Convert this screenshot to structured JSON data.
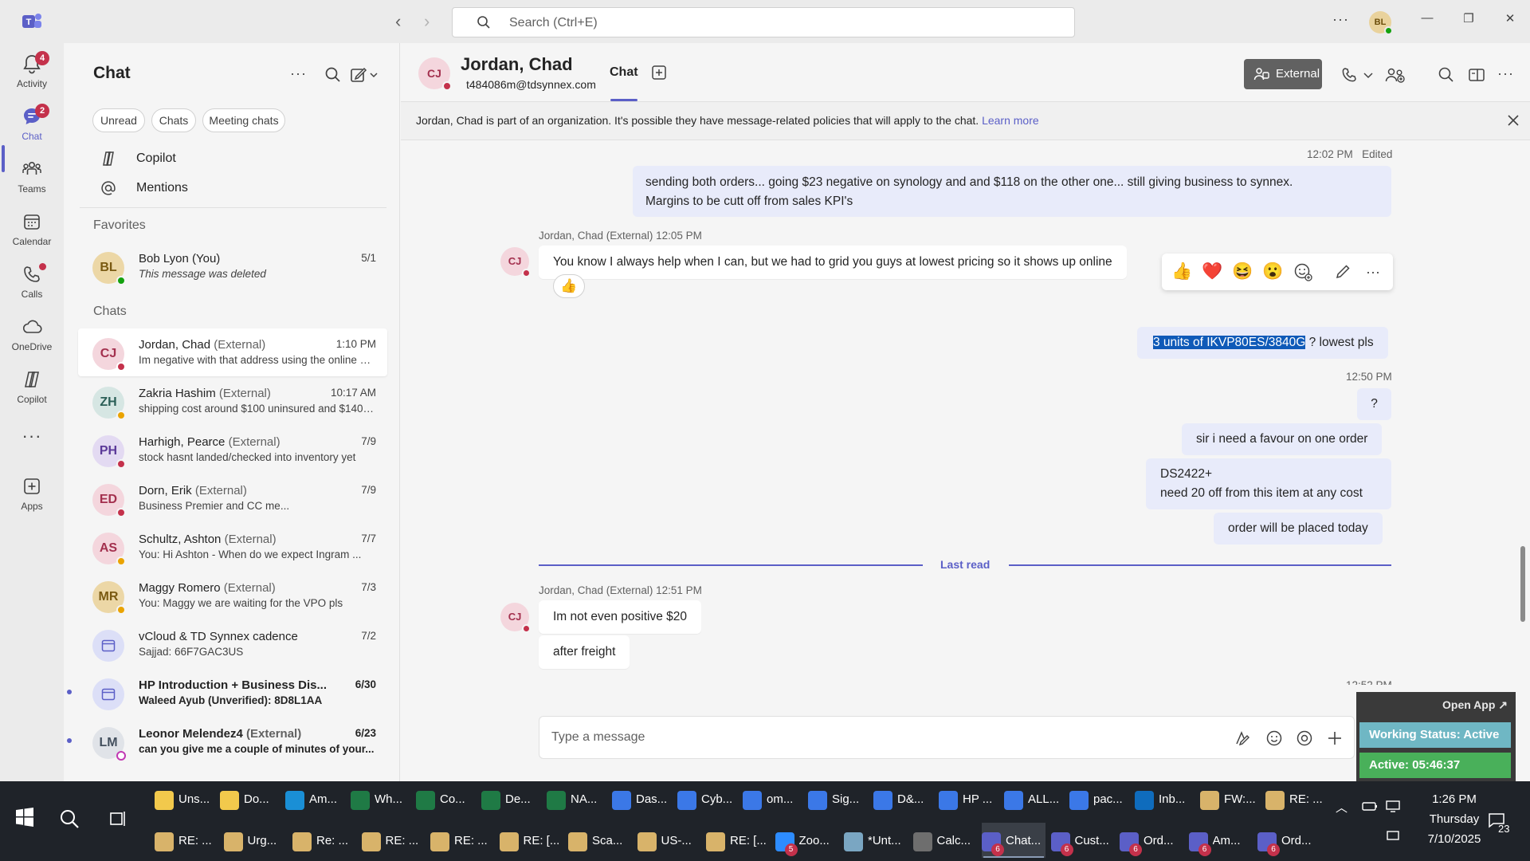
{
  "titlebar": {
    "search_placeholder": "Search (Ctrl+E)",
    "more_icon": "more-icon",
    "user_initials": "BL"
  },
  "rail": {
    "items": [
      {
        "label": "Activity",
        "icon": "bell-icon",
        "badge": "4"
      },
      {
        "label": "Chat",
        "icon": "chat-icon",
        "badge": "2"
      },
      {
        "label": "Teams",
        "icon": "teams-icon"
      },
      {
        "label": "Calendar",
        "icon": "calendar-icon"
      },
      {
        "label": "Calls",
        "icon": "phone-icon"
      },
      {
        "label": "OneDrive",
        "icon": "cloud-icon"
      },
      {
        "label": "Copilot",
        "icon": "copilot-icon"
      },
      {
        "label": "Apps",
        "icon": "add-apps-icon"
      }
    ]
  },
  "chatpanel": {
    "title": "Chat",
    "filters": [
      "Unread",
      "Chats",
      "Meeting chats"
    ],
    "nav": [
      {
        "label": "Copilot"
      },
      {
        "label": "Mentions"
      }
    ],
    "favorites_header": "Favorites",
    "favorites": [
      {
        "initials": "BL",
        "name": "Bob Lyon (You)",
        "preview": "This message was deleted",
        "time": "5/1"
      }
    ],
    "chats_header": "Chats",
    "chats": [
      {
        "initials": "CJ",
        "name": "Jordan, Chad",
        "ext": "(External)",
        "preview": "Im negative with that address using the online pricing...",
        "time": "1:10 PM"
      },
      {
        "initials": "ZH",
        "name": "Zakria Hashim",
        "ext": "(External)",
        "preview": "shipping cost around $100 uninsured and $140 insured",
        "time": "10:17 AM"
      },
      {
        "initials": "PH",
        "name": "Harhigh, Pearce",
        "ext": "(External)",
        "preview": "stock hasnt landed/checked into inventory yet",
        "time": "7/9"
      },
      {
        "initials": "ED",
        "name": "Dorn, Erik",
        "ext": "(External)",
        "preview": "Business Premier and CC me...",
        "time": "7/9"
      },
      {
        "initials": "AS",
        "name": "Schultz, Ashton",
        "ext": "(External)",
        "preview": "You: Hi Ashton -  When do we expect Ingram ...",
        "time": "7/7"
      },
      {
        "initials": "MR",
        "name": "Maggy Romero",
        "ext": "(External)",
        "preview": "You: Maggy we are waiting for the VPO pls",
        "time": "7/3"
      },
      {
        "initials": "",
        "name": "vCloud & TD Synnex cadence",
        "ext": "",
        "preview": "Sajjad: 66F7GAC3US",
        "time": "7/2"
      },
      {
        "initials": "",
        "name": "HP Introduction + Business Dis...",
        "ext": "",
        "preview": "Waleed Ayub (Unverified): 8D8L1AA",
        "time": "6/30"
      },
      {
        "initials": "LM",
        "name": "Leonor Melendez4",
        "ext": "(External)",
        "preview": "can you give me a couple of minutes of your...",
        "time": "6/23"
      }
    ]
  },
  "conversation": {
    "initials": "CJ",
    "name": "Jordan, Chad",
    "email": "t484086m@tdsynnex.com",
    "tab": "Chat",
    "external_label": "External",
    "banner_text": "Jordan, Chad is part of an organization. It's possible they have message-related policies that will apply to the chat.",
    "banner_link": "Learn more",
    "messages": {
      "m1_meta": "12:02 PM",
      "m1_edited": "Edited",
      "m1_line1": "sending both orders... going $23 negative on synology and and $118 on the other one... still giving business to synnex.",
      "m1_line2": "Margins to be cutt off from sales KPI's",
      "m2_meta": "Jordan, Chad (External)   12:05 PM",
      "m2_text": "You know I always help when I can, but we had to grid you guys at lowest pricing so it shows up online",
      "m2_reaction": "👍",
      "m3_selected": "3 units of IKVP80ES/3840G",
      "m3_rest": " ? lowest pls",
      "m4_meta": "12:50 PM",
      "m4_text": "?",
      "m5_text": "sir i need a favour on one order",
      "m6_line1": "DS2422+",
      "m6_line2": "need 20 off from this item at any cost",
      "m7_text": "order will be placed today",
      "last_read": "Last read",
      "m8_meta": "Jordan, Chad (External)   12:51 PM",
      "m8_text": "Im not even positive $20",
      "m9_text": "after freight",
      "m10_meta": "12:52 PM"
    },
    "reactions": [
      "👍",
      "❤️",
      "😆",
      "😮",
      "add-reaction-icon",
      "edit-icon",
      "more-icon"
    ],
    "composer_placeholder": "Type a message"
  },
  "widget": {
    "open_app": "Open App ↗",
    "working_status": "Working Status: Active",
    "active_time": "Active: 05:46:37"
  },
  "taskbar": {
    "row1": [
      {
        "label": "Uns...",
        "color": "#f2c94c"
      },
      {
        "label": "Do...",
        "color": "#f2c94c"
      },
      {
        "label": "Am...",
        "color": "#1a8fd6"
      },
      {
        "label": "Wh...",
        "color": "#1f7a45"
      },
      {
        "label": "Co...",
        "color": "#1f7a45"
      },
      {
        "label": "De...",
        "color": "#1f7a45"
      },
      {
        "label": "NA...",
        "color": "#1f7a45"
      },
      {
        "label": "Das...",
        "color": "#3b78e7"
      },
      {
        "label": "Cyb...",
        "color": "#3b78e7"
      },
      {
        "label": "om...",
        "color": "#3b78e7"
      },
      {
        "label": "Sig...",
        "color": "#3b78e7"
      },
      {
        "label": "D&...",
        "color": "#3b78e7"
      },
      {
        "label": "HP ...",
        "color": "#3b78e7"
      },
      {
        "label": "ALL...",
        "color": "#3b78e7"
      },
      {
        "label": "pac...",
        "color": "#3b78e7"
      },
      {
        "label": "Inb...",
        "color": "#0f6cbd"
      },
      {
        "label": "FW:...",
        "color": "#d8b36a"
      },
      {
        "label": "RE: ...",
        "color": "#d8b36a"
      }
    ],
    "row2": [
      {
        "label": "RE: ...",
        "color": "#d8b36a"
      },
      {
        "label": "Urg...",
        "color": "#d8b36a"
      },
      {
        "label": "Re: ...",
        "color": "#d8b36a"
      },
      {
        "label": "RE: ...",
        "color": "#d8b36a"
      },
      {
        "label": "RE: ...",
        "color": "#d8b36a"
      },
      {
        "label": "RE: [...",
        "color": "#d8b36a"
      },
      {
        "label": "Sca...",
        "color": "#d8b36a"
      },
      {
        "label": "US-...",
        "color": "#d8b36a"
      },
      {
        "label": "RE: [...",
        "color": "#d8b36a"
      },
      {
        "label": "Zoo...",
        "color": "#2d8cff",
        "badge": "5"
      },
      {
        "label": "*Unt...",
        "color": "#7aa6c2"
      },
      {
        "label": "Calc...",
        "color": "#6e6e6e"
      },
      {
        "label": "Chat...",
        "color": "#5b5fc7",
        "badge": "6",
        "active": true
      },
      {
        "label": "Cust...",
        "color": "#5b5fc7",
        "badge": "6"
      },
      {
        "label": "Ord...",
        "color": "#5b5fc7",
        "badge": "6"
      },
      {
        "label": "Am...",
        "color": "#5b5fc7",
        "badge": "6"
      },
      {
        "label": "Ord...",
        "color": "#5b5fc7",
        "badge": "6"
      }
    ],
    "time": "1:26 PM",
    "day": "Thursday",
    "date": "7/10/2025",
    "notifications": "23"
  }
}
